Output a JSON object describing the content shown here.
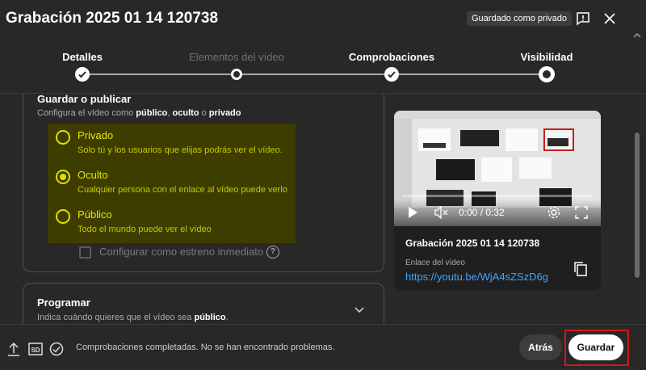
{
  "header": {
    "title": "Grabación 2025 01 14 120738",
    "saved_badge": "Guardado como privado",
    "feedback_icon": "feedback-icon",
    "close_icon": "close-icon"
  },
  "stepper": {
    "steps": [
      {
        "label": "Detalles",
        "state": "done"
      },
      {
        "label": "Elementos del vídeo",
        "state": "skipped"
      },
      {
        "label": "Comprobaciones",
        "state": "done"
      },
      {
        "label": "Visibilidad",
        "state": "current"
      }
    ]
  },
  "visibility": {
    "title": "Guardar o publicar",
    "subtitle_prefix": "Configura el vídeo como ",
    "opt_public": "público",
    "sep1": ", ",
    "opt_hidden": "oculto",
    "sep2": " o ",
    "opt_private": "privado",
    "options": [
      {
        "label": "Privado",
        "desc": "Solo tú y los usuarios que elijas podrás ver el vídeo.",
        "selected": false
      },
      {
        "label": "Oculto",
        "desc": "Cualquier persona con el enlace al vídeo puede verlo",
        "selected": true
      },
      {
        "label": "Público",
        "desc": "Todo el mundo puede ver el vídeo",
        "selected": false
      }
    ],
    "premiere_label": "Configurar como estreno inmediato",
    "premiere_checked": false
  },
  "schedule": {
    "title": "Programar",
    "subtitle_prefix": "Indica cuándo quieres que el vídeo sea ",
    "subtitle_bold": "público",
    "subtitle_suffix": "."
  },
  "preview": {
    "timecode": "0:00 / 0:32",
    "video_title": "Grabación 2025 01 14 120738",
    "link_label": "Enlace del vídeo",
    "link": "https://youtu.be/WjA4sZSzD6g"
  },
  "footer": {
    "status": "Comprobaciones completadas. No se han encontrado problemas.",
    "hd_badge": "SD",
    "back_label": "Atrás",
    "save_label": "Guardar"
  },
  "colors": {
    "background": "#282828",
    "highlight": "#3d3d00",
    "radio_accent": "#e0e000",
    "link": "#3ea6ff",
    "save_outline": "#d01818"
  }
}
